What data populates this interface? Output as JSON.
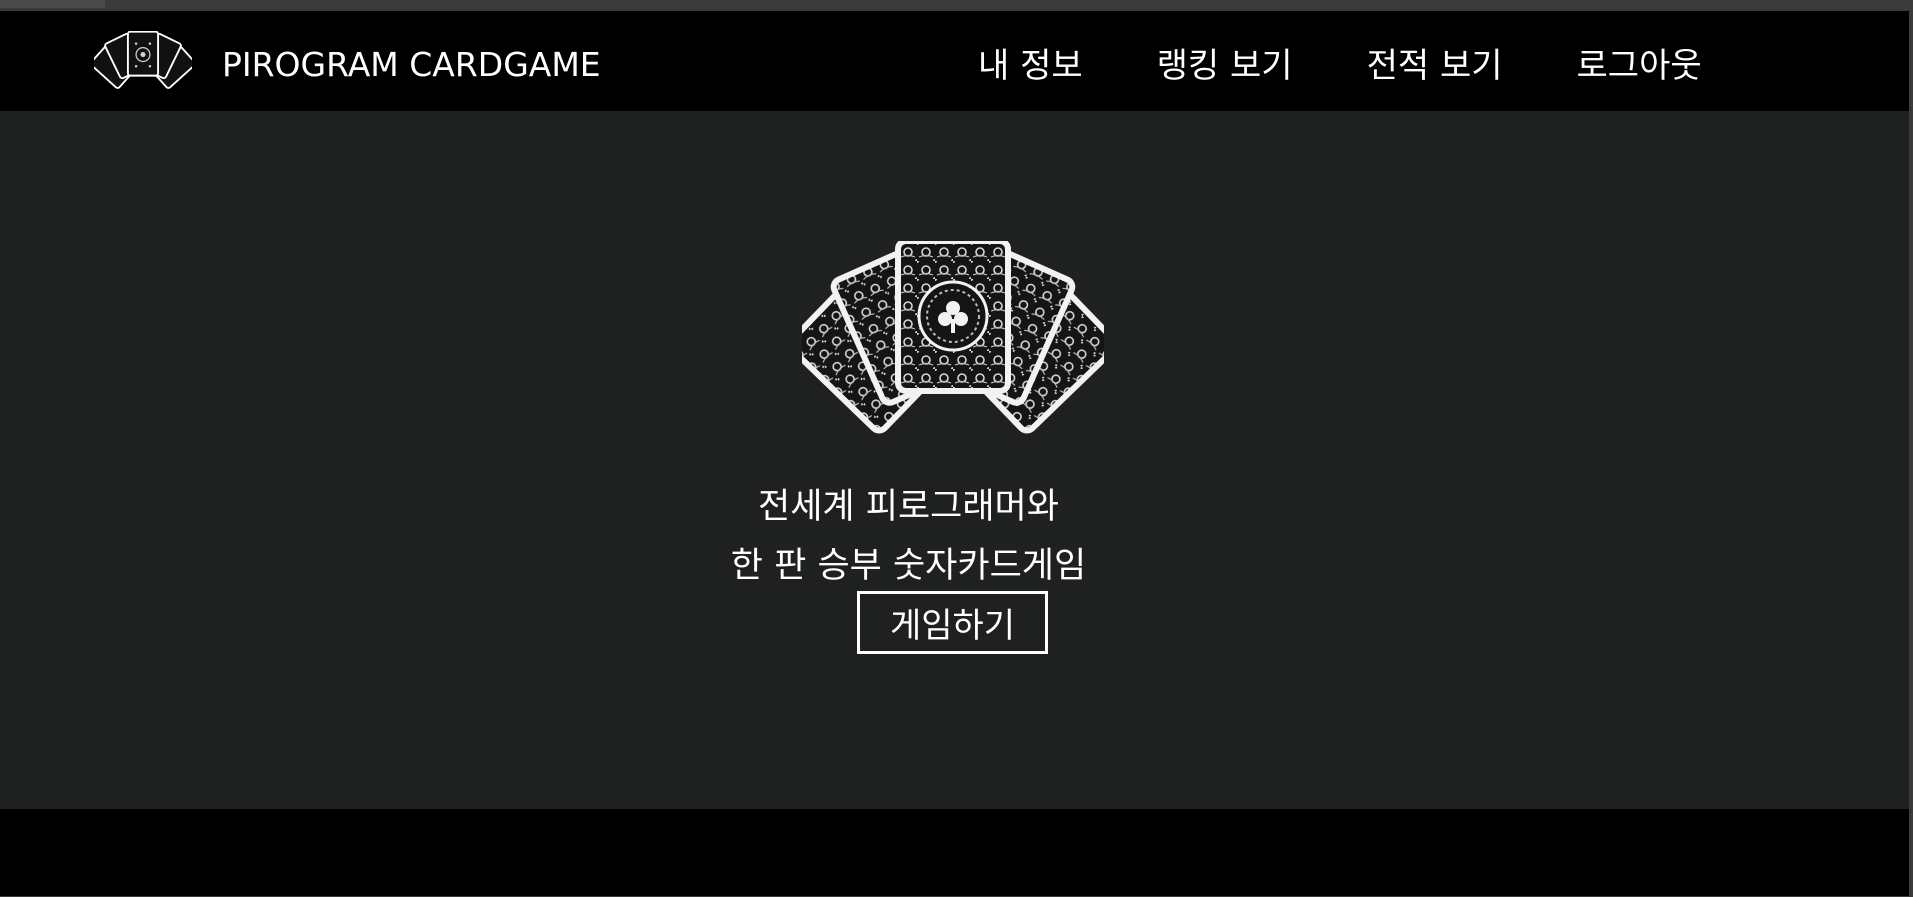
{
  "header": {
    "brand_title": "PIROGRAM CARDGAME",
    "logo_icon": "playing-cards-fan-icon",
    "nav": [
      {
        "label": "내 정보"
      },
      {
        "label": "랭킹 보기"
      },
      {
        "label": "전적 보기"
      },
      {
        "label": "로그아웃"
      }
    ]
  },
  "hero": {
    "image_icon": "playing-cards-fan-icon",
    "line1": "전세계 피로그래머와",
    "line2": "한 판 승부 숫자카드게임",
    "play_button": "게임하기"
  },
  "colors": {
    "navbar": "#000000",
    "body": "#1f2020",
    "footer": "#000000",
    "text": "#ffffff"
  }
}
